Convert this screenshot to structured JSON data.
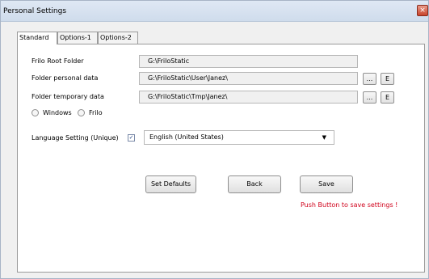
{
  "window": {
    "title": "Personal Settings",
    "close_symbol": "×"
  },
  "tabs": [
    {
      "label": "Standard"
    },
    {
      "label": "Options-1"
    },
    {
      "label": "Options-2"
    }
  ],
  "fields": {
    "root_folder": {
      "label": "Frilo Root Folder",
      "value": "G:\\FriloStatic"
    },
    "personal_folder": {
      "label": "Folder personal data",
      "value": "G:\\FriloStatic\\User\\Janez\\"
    },
    "temp_folder": {
      "label": "Folder temporary data",
      "value": "G:\\FriloStatic\\Tmp\\Janez\\"
    }
  },
  "browse_label": "...",
  "explore_label": "E",
  "radio": {
    "windows_label": "Windows",
    "frilo_label": "Frilo"
  },
  "language": {
    "label": "Language Setting (Unique)",
    "checkbox_mark": "✓",
    "selected": "English (United States)"
  },
  "buttons": {
    "set_defaults": "Set Defaults",
    "back": "Back",
    "save": "Save"
  },
  "hint": "Push Button to save settings !"
}
